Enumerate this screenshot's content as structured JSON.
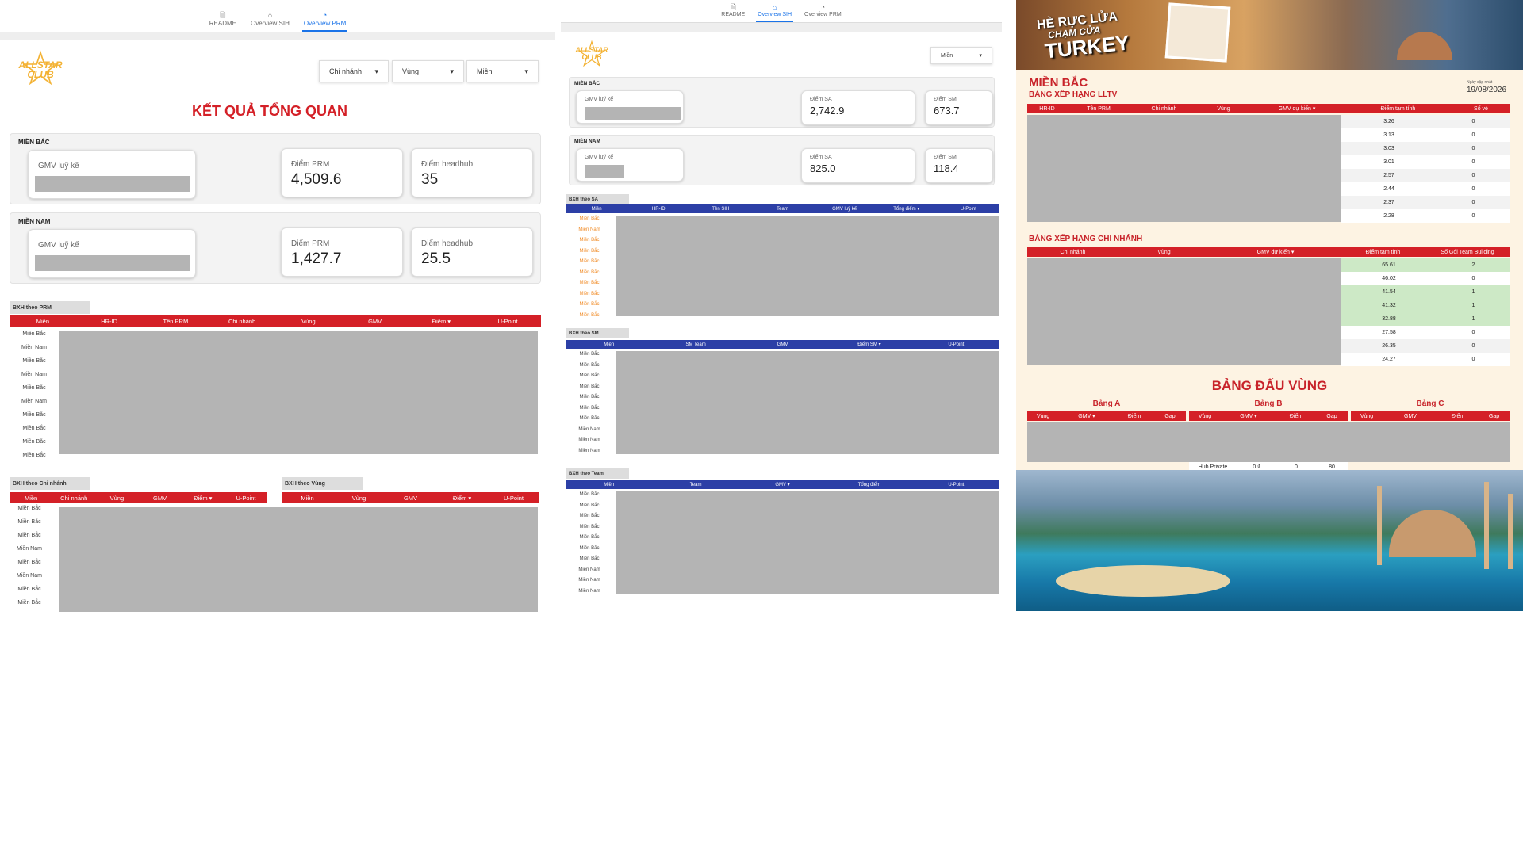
{
  "panel1": {
    "tabs": [
      {
        "label": "README",
        "active": false
      },
      {
        "label": "Overview SIH",
        "active": false
      },
      {
        "label": "Overview PRM",
        "active": true
      }
    ],
    "logo": {
      "line1": "ALLSTAR",
      "line2": "CLUB"
    },
    "filters": [
      "Chi nhánh",
      "Vùng",
      "Miền"
    ],
    "title": "KẾT QUẢ TỔNG QUAN",
    "regions": [
      {
        "name": "MIỀN BẮC",
        "gmv_label": "GMV luỹ kế",
        "prm_label": "Điểm PRM",
        "prm_value": "4,509.6",
        "hub_label": "Điểm headhub",
        "hub_value": "35"
      },
      {
        "name": "MIỀN NAM",
        "gmv_label": "GMV luỹ kế",
        "prm_label": "Điểm PRM",
        "prm_value": "1,427.7",
        "hub_label": "Điểm headhub",
        "hub_value": "25.5"
      }
    ],
    "prm_table": {
      "title": "BXH theo PRM",
      "columns": [
        "Miền",
        "HR-ID",
        "Tên PRM",
        "Chi nhánh",
        "Vùng",
        "GMV",
        "Điểm ▾",
        "U-Point"
      ],
      "rows": [
        "Miền Bắc",
        "Miền Nam",
        "Miền Bắc",
        "Miền Nam",
        "Miền Bắc",
        "Miền Nam",
        "Miền Bắc",
        "Miền Bắc",
        "Miền Bắc",
        "Miền Bắc"
      ]
    },
    "branch_table": {
      "title": "BXH theo Chi nhánh",
      "columns": [
        "Miền",
        "Chi nhánh",
        "Vùng",
        "GMV",
        "Điểm ▾",
        "U-Point"
      ],
      "rows": [
        "Miền Bắc",
        "Miền Bắc",
        "Miền Bắc",
        "Miền Nam",
        "Miền Bắc",
        "Miền Nam",
        "Miền Bắc",
        "Miền Bắc"
      ]
    },
    "zone_table": {
      "title": "BXH theo Vùng",
      "columns": [
        "Miền",
        "Vùng",
        "GMV",
        "Điểm ▾",
        "U-Point"
      ]
    }
  },
  "panel2": {
    "tabs": [
      {
        "label": "README",
        "active": false
      },
      {
        "label": "Overview SIH",
        "active": true
      },
      {
        "label": "Overview PRM",
        "active": false
      }
    ],
    "logo": {
      "line1": "ALLSTAR",
      "line2": "CLUB"
    },
    "filter": "Miền",
    "regions": [
      {
        "name": "MIỀN BẮC",
        "gmv_label": "GMV luỹ kế",
        "sa_label": "Điểm SA",
        "sa_value": "2,742.9",
        "sm_label": "Điểm SM",
        "sm_value": "673.7"
      },
      {
        "name": "MIỀN NAM",
        "gmv_label": "GMV luỹ kế",
        "sa_label": "Điểm SA",
        "sa_value": "825.0",
        "sm_label": "Điểm SM",
        "sm_value": "118.4"
      }
    ],
    "sa_table": {
      "title": "BXH theo SA",
      "columns": [
        "Miền",
        "HR-ID",
        "Tên SIH",
        "Team",
        "GMV luỹ kế",
        "Tổng điểm ▾",
        "U-Point"
      ],
      "rows": [
        "Miền Bắc",
        "Miền Nam",
        "Miền Bắc",
        "Miền Bắc",
        "Miền Bắc",
        "Miền Bắc",
        "Miền Bắc",
        "Miền Bắc",
        "Miền Bắc",
        "Miền Bắc"
      ]
    },
    "sm_table": {
      "title": "BXH theo SM",
      "columns": [
        "Miền",
        "SM Team",
        "GMV",
        "Điểm SM ▾",
        "U-Point"
      ],
      "rows": [
        "Miền Bắc",
        "Miền Bắc",
        "Miền Bắc",
        "Miền Bắc",
        "Miền Bắc",
        "Miền Bắc",
        "Miền Bắc",
        "Miền Nam",
        "Miền Nam",
        "Miền Nam"
      ]
    },
    "team_table": {
      "title": "BXH theo Team",
      "columns": [
        "Miền",
        "Team",
        "GMV ▾",
        "Tổng điểm",
        "U-Point"
      ],
      "rows": [
        "Miền Bắc",
        "Miền Bắc",
        "Miền Bắc",
        "Miền Bắc",
        "Miền Bắc",
        "Miền Bắc",
        "Miền Bắc",
        "Miền Nam",
        "Miền Nam",
        "Miền Nam"
      ]
    }
  },
  "panel3": {
    "banner": {
      "line1": "HÈ RỰC LỬA",
      "line2": "CHẠM CỬA",
      "line3": "TURKEY"
    },
    "region_title": "MIỀN BẮC",
    "update_label": "Ngày cập nhật",
    "update_date": "19/08/2026",
    "lltv": {
      "title": "BẢNG XẾP HẠNG LLTV",
      "columns": [
        "HR-ID",
        "Tên PRM",
        "Chi nhánh",
        "Vùng",
        "GMV dự kiến ▾",
        "Điểm tạm tính",
        "Số vé"
      ],
      "scores": [
        "3.26",
        "3.13",
        "3.03",
        "3.01",
        "2.57",
        "2.44",
        "2.37",
        "2.28"
      ],
      "tickets": [
        "0",
        "0",
        "0",
        "0",
        "0",
        "0",
        "0",
        "0"
      ]
    },
    "branch": {
      "title": "BẢNG XẾP HẠNG CHI NHÁNH",
      "columns": [
        "Chi nhánh",
        "Vùng",
        "GMV dự kiến ▾",
        "Điểm tạm tính",
        "Số Gói Team Building"
      ],
      "scores": [
        "65.61",
        "46.02",
        "41.54",
        "41.32",
        "32.88",
        "27.58",
        "26.35",
        "24.27"
      ],
      "packs": [
        "2",
        "0",
        "1",
        "1",
        "1",
        "0",
        "0",
        "0"
      ],
      "highlight": [
        true,
        false,
        true,
        true,
        true,
        false,
        false,
        false
      ]
    },
    "zone": {
      "title": "BẢNG ĐẤU VÙNG",
      "groups": [
        {
          "name": "Bảng A",
          "columns": [
            "Vùng",
            "GMV ▾",
            "Điểm",
            "Gap"
          ]
        },
        {
          "name": "Bảng B",
          "columns": [
            "Vùng",
            "GMV ▾",
            "Điểm",
            "Gap"
          ]
        },
        {
          "name": "Bảng C",
          "columns": [
            "Vùng",
            "GMV",
            "Điểm",
            "Gap"
          ]
        }
      ],
      "footer_row": [
        "Hub Private",
        "0 ₫",
        "0",
        "80"
      ]
    }
  },
  "colors": {
    "table_red": "#d42027",
    "table_blue": "#2c3fa6",
    "title_red": "#c8232a",
    "gold": "#f3b234",
    "active_tab": "#1a73e8"
  }
}
